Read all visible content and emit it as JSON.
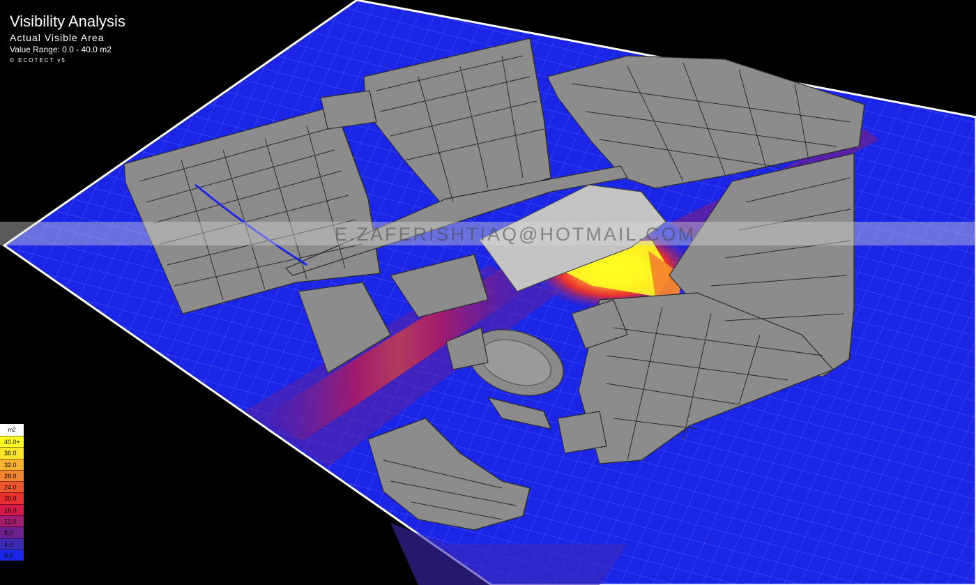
{
  "header": {
    "title": "Visibility Analysis",
    "subtitle": "Actual Visible Area",
    "range": "Value Range: 0.0 - 40.0 m2",
    "credit": "© ECOTECT v5"
  },
  "watermark": "E.ZAFERISHTIAQ@HOTMAIL.COM",
  "legend": {
    "unit": "m2",
    "items": [
      {
        "label": "40.0+",
        "color": "#ffff22"
      },
      {
        "label": "36.0",
        "color": "#fce529"
      },
      {
        "label": "32.0",
        "color": "#f9b22c"
      },
      {
        "label": "28.0",
        "color": "#f6852d"
      },
      {
        "label": "24.0",
        "color": "#f1572f"
      },
      {
        "label": "20.0",
        "color": "#e9302f"
      },
      {
        "label": "16.0",
        "color": "#d6184a"
      },
      {
        "label": "12.0",
        "color": "#a51c6e"
      },
      {
        "label": "8.0",
        "color": "#6f208f"
      },
      {
        "label": "4.0",
        "color": "#3d2ab5"
      },
      {
        "label": "0.0",
        "color": "#1b25e5"
      }
    ]
  },
  "colors": {
    "background": "#000000",
    "grid_low": "#1b25e5",
    "building": "#8c8c8c",
    "building_outline": "#2a2a2a"
  }
}
